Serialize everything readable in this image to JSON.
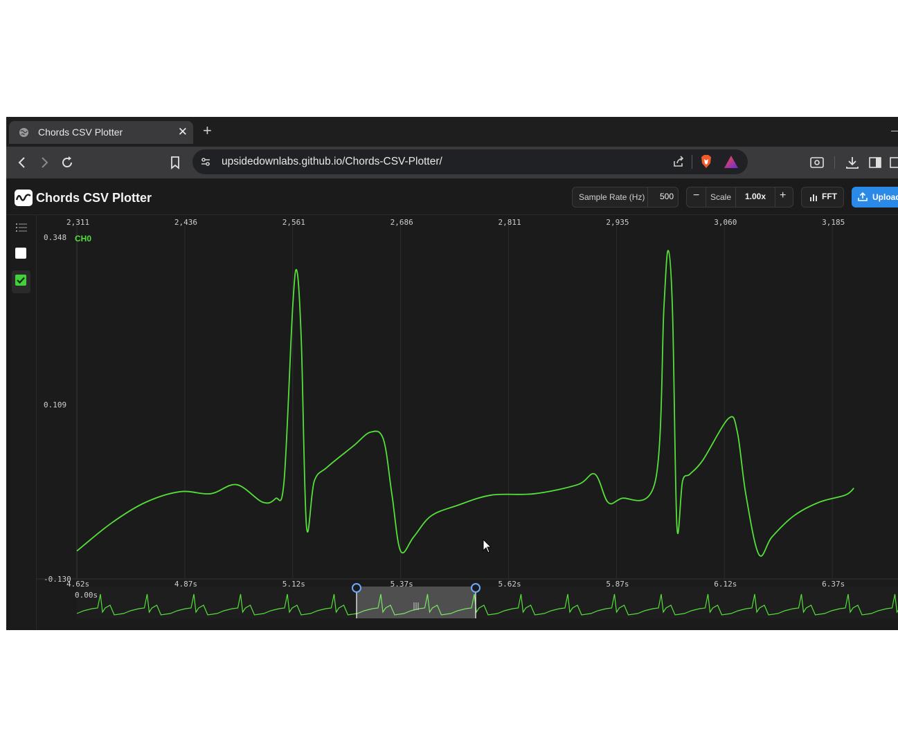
{
  "browser": {
    "tab_title": "Chords CSV Plotter",
    "tab_close": "✕",
    "new_tab": "+",
    "url": "upsidedownlabs.github.io/Chords-CSV-Plotter/"
  },
  "app": {
    "title": "Chords CSV Plotter",
    "sample_rate_label": "Sample Rate (Hz)",
    "sample_rate_value": "500",
    "scale_minus": "−",
    "scale_label": "Scale",
    "scale_value": "1.00x",
    "scale_plus": "+",
    "fft_label": "FFT",
    "upload_label": "Upload"
  },
  "sidebar": {
    "checkbox1_checked": false,
    "checkbox2_checked": true
  },
  "chart_data": {
    "type": "line",
    "series": [
      {
        "name": "CH0",
        "color": "#55e03a"
      }
    ],
    "top_ticks": [
      "2,311",
      "2,436",
      "2,561",
      "2,686",
      "2,811",
      "2,935",
      "3,060",
      "3,185"
    ],
    "bottom_ticks": [
      "4.62s",
      "4.87s",
      "5.12s",
      "5.37s",
      "5.62s",
      "5.87s",
      "6.12s",
      "6.37s"
    ],
    "y_ticks": [
      "0.348",
      "0.109",
      "-0.130"
    ],
    "ylim": [
      -0.13,
      0.348
    ],
    "grid": true,
    "overview_start_label": "0.00s",
    "x_seconds": [
      4.62,
      4.7,
      4.78,
      4.86,
      4.93,
      4.99,
      5.05,
      5.08,
      5.1,
      5.12,
      5.13,
      5.14,
      5.152,
      5.17,
      5.2,
      5.26,
      5.3,
      5.33,
      5.35,
      5.37,
      5.4,
      5.44,
      5.5,
      5.58,
      5.68,
      5.78,
      5.82,
      5.85,
      5.88,
      5.96,
      5.98,
      5.99,
      6.0,
      6.01,
      6.023,
      6.04,
      6.07,
      6.13,
      6.15,
      6.17,
      6.2,
      6.23,
      6.28,
      6.34,
      6.4,
      6.42
    ],
    "y_values": [
      -0.1,
      -0.06,
      -0.03,
      -0.015,
      -0.018,
      -0.005,
      -0.03,
      -0.025,
      0.0,
      0.25,
      0.3,
      0.2,
      -0.065,
      -0.0,
      0.02,
      0.05,
      0.07,
      0.06,
      -0.02,
      -0.1,
      -0.08,
      -0.05,
      -0.035,
      -0.02,
      -0.018,
      -0.005,
      0.01,
      -0.03,
      -0.025,
      0.0,
      0.25,
      0.33,
      0.24,
      -0.065,
      -0.0,
      0.01,
      0.03,
      0.09,
      0.07,
      -0.02,
      -0.105,
      -0.08,
      -0.05,
      -0.03,
      -0.02,
      -0.01
    ]
  }
}
